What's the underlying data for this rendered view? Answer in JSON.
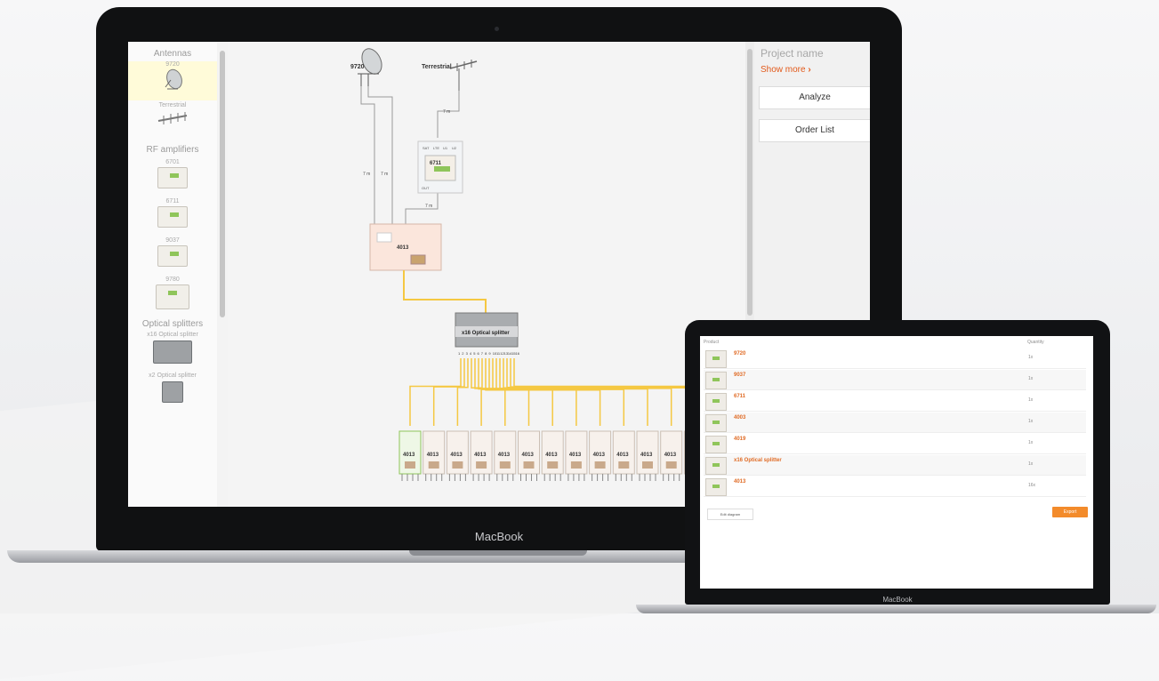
{
  "macbook": {
    "brand": "MacBook",
    "palette": {
      "sections": [
        {
          "title": "Antennas",
          "items": [
            {
              "label": "9720",
              "selected": true
            },
            {
              "label": "Terrestrial"
            }
          ]
        },
        {
          "title": "RF amplifiers",
          "items": [
            {
              "label": "6701"
            },
            {
              "label": "6711"
            },
            {
              "label": "9037"
            },
            {
              "label": "9780"
            }
          ]
        },
        {
          "title": "Optical splitters",
          "items": [
            {
              "label": "x16 Optical splitter"
            },
            {
              "label": "x2 Optical splitter"
            }
          ]
        }
      ]
    },
    "canvas": {
      "dish_label": "9720",
      "terrestrial_label": "Terrestrial",
      "amp_label": "6711",
      "amp_inputs": [
        "SAT",
        "LTE",
        "U1",
        "U2"
      ],
      "amp_out_label": "OUT",
      "converter_label": "4013",
      "splitter_label": "x16 Optical splitter",
      "splitter_ports": [
        "1",
        "2",
        "3",
        "4",
        "5",
        "6",
        "7",
        "8",
        "9",
        "10",
        "11",
        "12",
        "13",
        "14",
        "15",
        "16"
      ],
      "receiver_label": "4013",
      "receiver_count": 16,
      "cable_labels": [
        "7 m",
        "7 m",
        "7 m",
        "7 m"
      ]
    },
    "right_panel": {
      "project_name": "Project name",
      "show_more": "Show more",
      "analyze_label": "Analyze",
      "order_list_label": "Order List"
    }
  },
  "macbook_small": {
    "brand": "MacBook",
    "order_list": {
      "col_product": "Product",
      "col_qty": "Quantity",
      "rows": [
        {
          "code": "9720",
          "qty": "1x"
        },
        {
          "code": "9037",
          "qty": "1x"
        },
        {
          "code": "6711",
          "qty": "1x"
        },
        {
          "code": "4003",
          "qty": "1x"
        },
        {
          "code": "4019",
          "qty": "1x"
        },
        {
          "code": "x16 Optical splitter",
          "qty": "1x"
        },
        {
          "code": "4013",
          "qty": "16x"
        }
      ],
      "back_label": "Edit diagram",
      "export_label": "Export"
    }
  },
  "colors": {
    "accent": "#e2591a",
    "cable": "#f5c842",
    "receiver_green": "#8fc55a"
  }
}
